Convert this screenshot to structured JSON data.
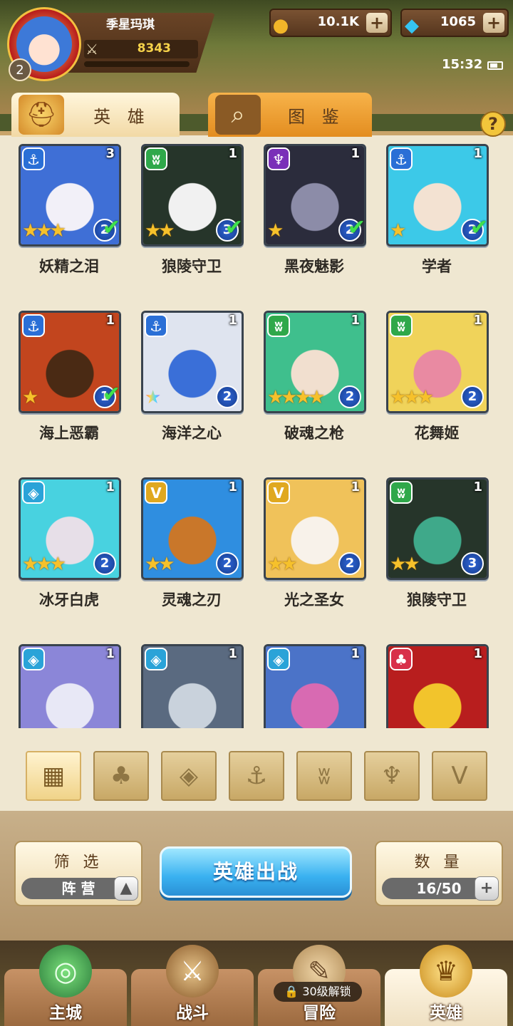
{
  "player": {
    "name": "季星玛琪",
    "level": "2",
    "power": "8343"
  },
  "currency": {
    "gold": "10.1K",
    "gems": "1065"
  },
  "status": {
    "time": "15:32"
  },
  "tabs": {
    "heroes": "英 雄",
    "codex": "图 鉴"
  },
  "help_label": "?",
  "factions": {
    "anchor": {
      "color": "#2a6fd6",
      "glyph": "⚓"
    },
    "beast": {
      "color": "#2fa84a",
      "glyph": "ʬ"
    },
    "shadow": {
      "color": "#7a2fb8",
      "glyph": "♆"
    },
    "crystal": {
      "color": "#2aa3d8",
      "glyph": "◈"
    },
    "holy": {
      "color": "#e0a81f",
      "glyph": "V"
    },
    "blood": {
      "color": "#d8304a",
      "glyph": "♣"
    }
  },
  "heroes": [
    {
      "name": "妖精之泪",
      "count": "3",
      "stars": 3,
      "rank": "2",
      "faction": "anchor",
      "checked": true,
      "portrait": [
        "#3f6fd6",
        "#f2f0f8"
      ]
    },
    {
      "name": "狼陵守卫",
      "count": "1",
      "stars": 2,
      "rank": "3",
      "faction": "beast",
      "checked": true,
      "portrait": [
        "#26352a",
        "#f1f1f1"
      ]
    },
    {
      "name": "黑夜魅影",
      "count": "1",
      "stars": 1,
      "rank": "2",
      "faction": "shadow",
      "checked": true,
      "portrait": [
        "#2b2c3c",
        "#8c8ca8"
      ]
    },
    {
      "name": "学者",
      "count": "1",
      "stars": 1,
      "rank": "2",
      "faction": "anchor",
      "checked": true,
      "portrait": [
        "#3cc9e8",
        "#f3e2d2"
      ]
    },
    {
      "name": "海上恶霸",
      "count": "1",
      "stars": 1,
      "rank": "1",
      "faction": "anchor",
      "checked": true,
      "portrait": [
        "#c2451e",
        "#4a2a14"
      ]
    },
    {
      "name": "海洋之心",
      "count": "1",
      "stars": 1,
      "rank": "2",
      "faction": "anchor",
      "checked": false,
      "rainbow": true,
      "portrait": [
        "#dfe4ef",
        "#3a6fd8"
      ]
    },
    {
      "name": "破魂之枪",
      "count": "1",
      "stars": 4,
      "rank": "2",
      "faction": "beast",
      "checked": false,
      "portrait": [
        "#3fbf8d",
        "#f1dfcf"
      ]
    },
    {
      "name": "花舞姬",
      "count": "1",
      "stars": 3,
      "rank": "2",
      "faction": "beast",
      "checked": false,
      "portrait": [
        "#f0d35a",
        "#e98aa2"
      ]
    },
    {
      "name": "冰牙白虎",
      "count": "1",
      "stars": 3,
      "rank": "2",
      "faction": "crystal",
      "checked": false,
      "portrait": [
        "#48d2e0",
        "#e7dfe8"
      ]
    },
    {
      "name": "灵魂之刃",
      "count": "1",
      "stars": 2,
      "rank": "2",
      "faction": "holy",
      "checked": false,
      "portrait": [
        "#2f8ee0",
        "#c9772a"
      ]
    },
    {
      "name": "光之圣女",
      "count": "1",
      "stars": 2,
      "rank": "2",
      "faction": "holy",
      "checked": false,
      "portrait": [
        "#f0c25a",
        "#f8f2ea"
      ]
    },
    {
      "name": "狼陵守卫",
      "count": "1",
      "stars": 2,
      "rank": "3",
      "faction": "beast",
      "checked": false,
      "portrait": [
        "#26352a",
        "#3fa98a"
      ]
    },
    {
      "name": "",
      "count": "1",
      "stars": 0,
      "rank": "",
      "faction": "crystal",
      "checked": false,
      "portrait": [
        "#8b86d8",
        "#e8e8f6"
      ]
    },
    {
      "name": "",
      "count": "1",
      "stars": 0,
      "rank": "",
      "faction": "crystal",
      "checked": false,
      "portrait": [
        "#5a6a80",
        "#c9d2dc"
      ]
    },
    {
      "name": "",
      "count": "1",
      "stars": 0,
      "rank": "",
      "faction": "crystal",
      "checked": false,
      "portrait": [
        "#4b73c8",
        "#d86ab2"
      ]
    },
    {
      "name": "",
      "count": "1",
      "stars": 0,
      "rank": "",
      "faction": "blood",
      "checked": false,
      "portrait": [
        "#b81e1e",
        "#f2c42c"
      ]
    }
  ],
  "filters": [
    {
      "id": "all",
      "glyph": "▦",
      "active": true
    },
    {
      "id": "blood",
      "glyph": "♣"
    },
    {
      "id": "crystal",
      "glyph": "◈"
    },
    {
      "id": "anchor",
      "glyph": "⚓"
    },
    {
      "id": "beast",
      "glyph": "ʬ"
    },
    {
      "id": "shadow",
      "glyph": "♆"
    },
    {
      "id": "holy",
      "glyph": "V"
    }
  ],
  "filter_box": {
    "title": "筛 选",
    "value": "阵 营"
  },
  "deploy_label": "英雄出战",
  "quantity_box": {
    "title": "数 量",
    "value": "16/50"
  },
  "nav": {
    "city": "主城",
    "battle": "战斗",
    "adventure": "冒险",
    "heroes": "英雄",
    "lock": "30级解锁"
  }
}
